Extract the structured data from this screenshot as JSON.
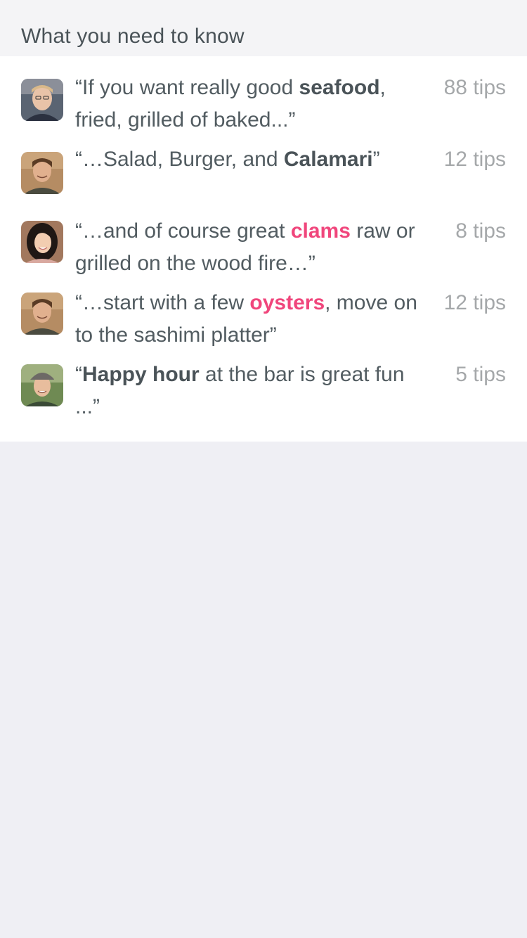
{
  "section": {
    "title": "What you need to know"
  },
  "tips": [
    {
      "avatar": "user-avatar-blonde-man",
      "parts": [
        {
          "t": "“If you want really good ",
          "s": "normal"
        },
        {
          "t": "seafood",
          "s": "bold"
        },
        {
          "t": ", fried, grilled of baked...”",
          "s": "normal"
        }
      ],
      "count": "88 tips"
    },
    {
      "avatar": "user-avatar-brown-hair-man",
      "parts": [
        {
          "t": "“…Salad, Burger, and ",
          "s": "normal"
        },
        {
          "t": "Calamari",
          "s": "bold"
        },
        {
          "t": "”",
          "s": "normal"
        }
      ],
      "count": "12 tips"
    },
    {
      "avatar": "user-avatar-woman",
      "parts": [
        {
          "t": "“…and of course great ",
          "s": "normal"
        },
        {
          "t": "clams",
          "s": "highlight"
        },
        {
          "t": " raw or grilled on the wood fire…”",
          "s": "normal"
        }
      ],
      "count": "8 tips"
    },
    {
      "avatar": "user-avatar-brown-hair-man",
      "parts": [
        {
          "t": "“…start with a few ",
          "s": "normal"
        },
        {
          "t": "oysters",
          "s": "highlight"
        },
        {
          "t": ", move on to the sashimi platter”",
          "s": "normal"
        }
      ],
      "count": "12 tips"
    },
    {
      "avatar": "user-avatar-man-with-cap",
      "parts": [
        {
          "t": "“",
          "s": "normal"
        },
        {
          "t": "Happy hour",
          "s": "bold"
        },
        {
          "t": " at the bar is great fun ...”",
          "s": "normal"
        }
      ],
      "count": "5 tips"
    }
  ],
  "colors": {
    "highlight": "#f0467c",
    "text": "#525c61",
    "count": "#a5a8aa",
    "background": "#efeff4"
  }
}
